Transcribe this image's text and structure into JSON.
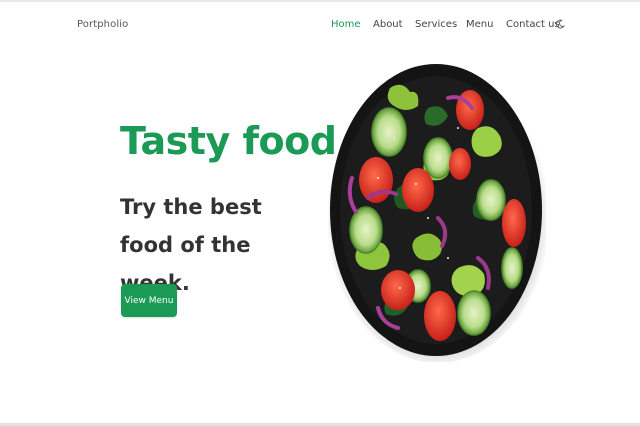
{
  "brand": "Portpholio",
  "nav": {
    "items": [
      {
        "label": "Home",
        "active": true
      },
      {
        "label": "About",
        "active": false
      },
      {
        "label": "Services",
        "active": false
      },
      {
        "label": "Menu",
        "active": false
      },
      {
        "label": "Contact us",
        "active": false
      }
    ],
    "theme_icon": "moon-icon"
  },
  "hero": {
    "title": "Tasty food",
    "subtitle": "Try the best food of the week.",
    "button_label": "View Menu"
  },
  "colors": {
    "accent": "#1a9a55",
    "text_dark": "#333333",
    "plate": "#151515"
  }
}
